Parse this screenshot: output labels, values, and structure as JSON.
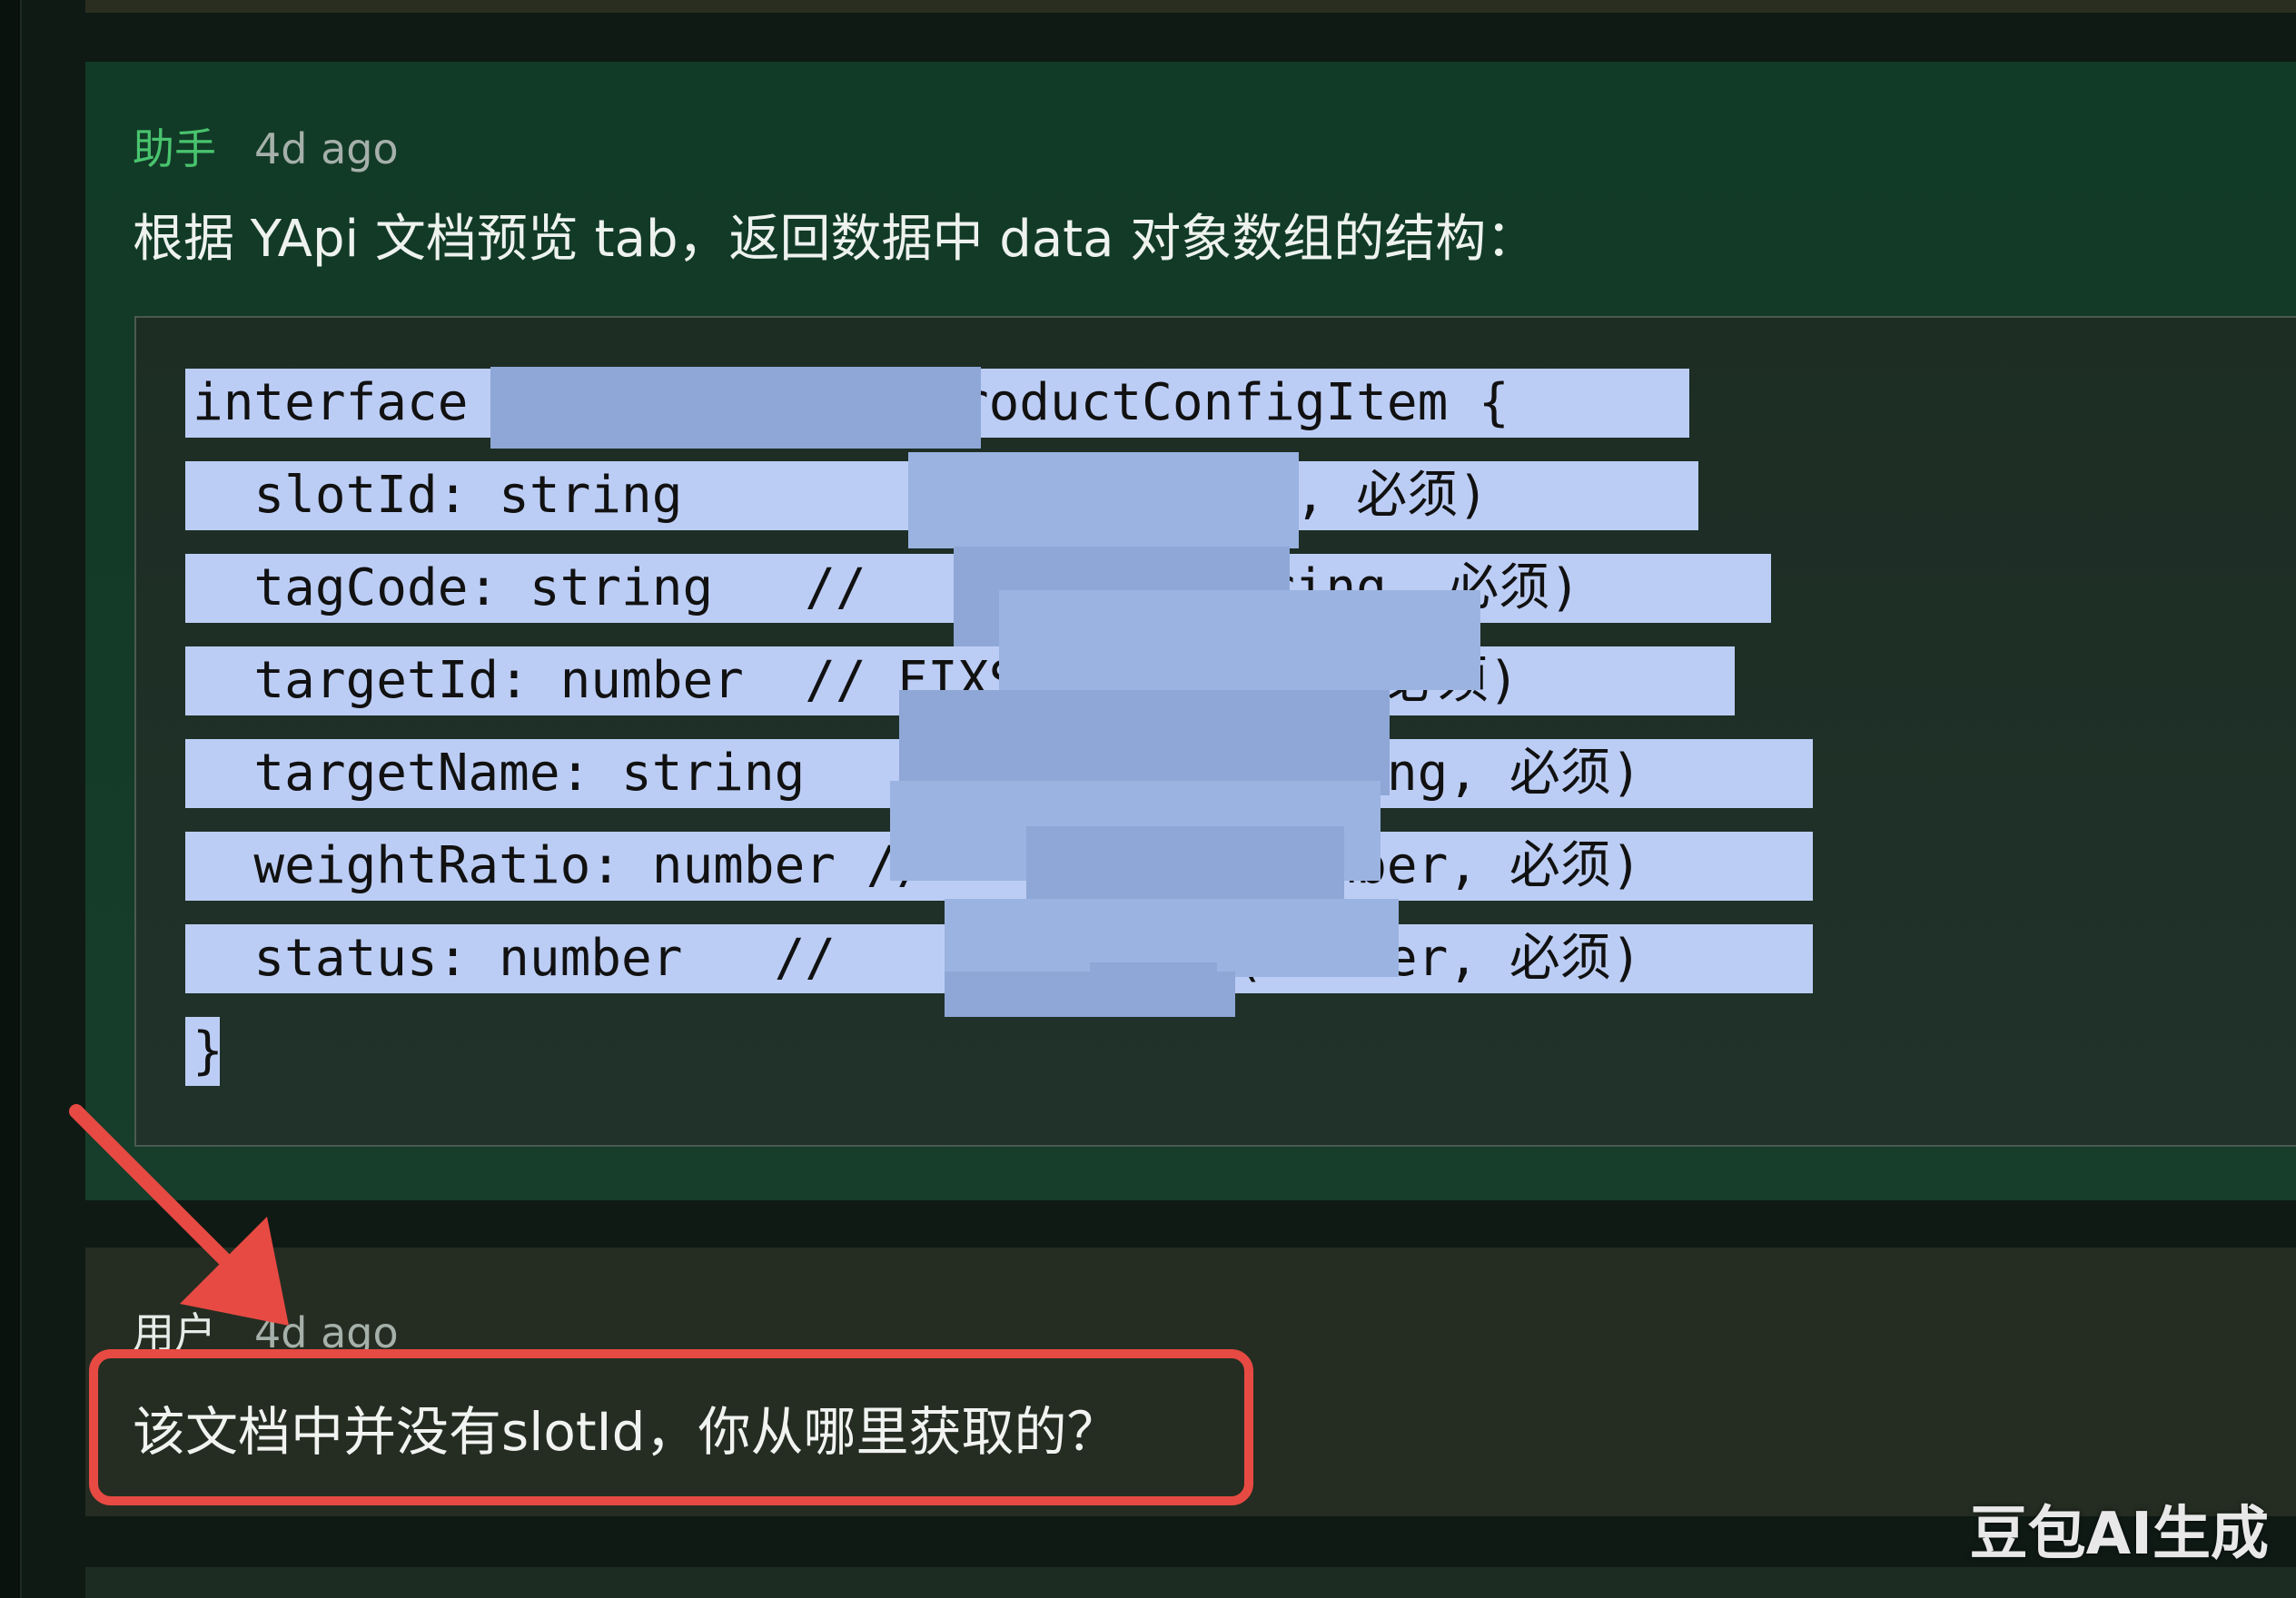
{
  "assistant": {
    "role": "助手",
    "time": "4d ago",
    "intro": "根据 YApi 文档预览 tab，返回数据中 data 对象数组的结构：",
    "code_lines": [
      "interface              yProductConfigItem {",
      "  slotId: string               tring, 必须)",
      "  tagCode: string   //          (string, 必须)",
      "  targetId: number  // FIXS         r, 必须)",
      "  targetName: string               string, 必须)",
      "  weightRatio: number //          (number, 必须)",
      "  status: number   //             (number, 必须)",
      "}"
    ]
  },
  "user": {
    "role": "用户",
    "time": "4d ago",
    "text": "该文档中并没有slotId，你从哪里获取的？"
  },
  "watermark": "豆包AI生成",
  "colors": {
    "assistant_role": "#49c46e",
    "highlight": "#e74a43",
    "code_highlight": "#bccdf5"
  }
}
